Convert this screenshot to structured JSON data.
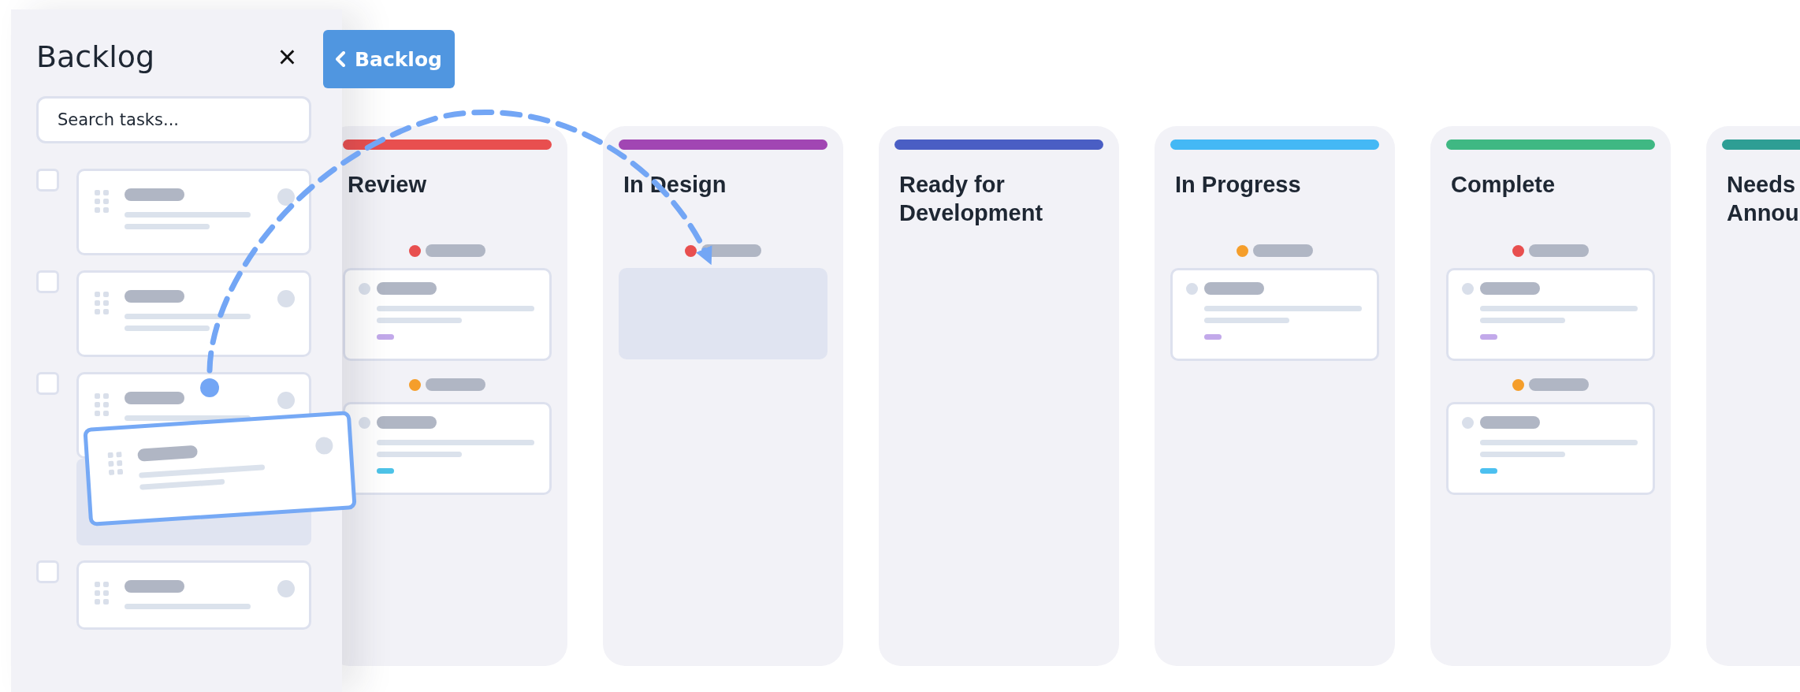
{
  "backlog_panel": {
    "title": "Backlog",
    "close_label": "×",
    "search": {
      "placeholder": "Search tasks..."
    },
    "items": [
      {
        "kind": "full",
        "checked": false,
        "dragging": false
      },
      {
        "kind": "full",
        "checked": false,
        "dragging": false
      },
      {
        "kind": "full",
        "checked": false,
        "dragging": true
      },
      {
        "kind": "short",
        "checked": false,
        "dragging": false
      }
    ]
  },
  "toggle_button": {
    "label": "Backlog"
  },
  "columns": [
    {
      "title": "Review",
      "color": "#e84f4f",
      "groups": [
        {
          "color": "#e84f4f",
          "drop_target": false,
          "tag": {
            "color": "#c2a9ea"
          }
        },
        {
          "color": "#f59e2b",
          "drop_target": false,
          "tag": {
            "color": "#4dc3e8"
          }
        }
      ]
    },
    {
      "title": "In Design",
      "color": "#a146b3",
      "groups": [
        {
          "color": "#e84f4f",
          "drop_target": true
        }
      ]
    },
    {
      "title": "Ready for\nDevelopment",
      "color": "#4a5ec4"
    },
    {
      "title": "In Progress",
      "color": "#44b8f5",
      "groups": [
        {
          "color": "#f59e2b",
          "drop_target": false,
          "tag": {
            "color": "#c2a9ea"
          }
        }
      ]
    },
    {
      "title": "Complete",
      "color": "#3fb883",
      "groups": [
        {
          "color": "#e84f4f",
          "drop_target": false,
          "tag": {
            "color": "#c2a9ea"
          }
        },
        {
          "color": "#f59e2b",
          "drop_target": false,
          "tag": {
            "color": "#4cc0f0"
          }
        }
      ]
    },
    {
      "title": "Needs\nAnnou",
      "color": "#2e9e94"
    }
  ]
}
